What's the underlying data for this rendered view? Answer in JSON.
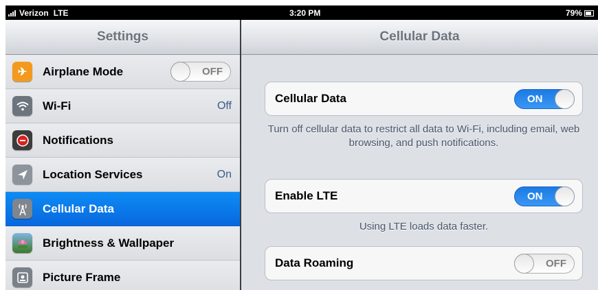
{
  "status_bar": {
    "carrier": "Verizon",
    "network": "LTE",
    "time": "3:20 PM",
    "battery_text": "79%",
    "battery_level": 0.79
  },
  "sidebar": {
    "title": "Settings",
    "items": [
      {
        "label": "Airplane Mode",
        "icon": "airplane-icon",
        "icon_glyph": "✈",
        "icon_color": "#f39a1e",
        "toggle": "OFF"
      },
      {
        "label": "Wi-Fi",
        "icon": "wifi-icon",
        "icon_glyph": "≋",
        "icon_color": "#6c747e",
        "value": "Off"
      },
      {
        "label": "Notifications",
        "icon": "notifications-icon",
        "icon_glyph": "●",
        "icon_color": "#d6241e"
      },
      {
        "label": "Location Services",
        "icon": "location-arrow-icon",
        "icon_glyph": "➤",
        "icon_color": "#8d949c",
        "value": "On"
      },
      {
        "label": "Cellular Data",
        "icon": "cellular-antenna-icon",
        "icon_glyph": "⌖",
        "icon_color": "#7f868e",
        "selected": true
      },
      {
        "label": "Brightness & Wallpaper",
        "icon": "flower-icon",
        "icon_glyph": "✿",
        "icon_color": "#4f8f3a"
      },
      {
        "label": "Picture Frame",
        "icon": "picture-frame-icon",
        "icon_glyph": "▣",
        "icon_color": "#7a8189"
      }
    ]
  },
  "detail": {
    "title": "Cellular Data",
    "cellular_data": {
      "label": "Cellular Data",
      "toggle": "ON"
    },
    "cellular_data_footer": "Turn off cellular data to restrict all data to Wi-Fi, including email, web browsing, and push notifications.",
    "enable_lte": {
      "label": "Enable LTE",
      "toggle": "ON"
    },
    "enable_lte_footer": "Using LTE loads data faster.",
    "data_roaming": {
      "label": "Data Roaming",
      "toggle": "OFF"
    }
  },
  "colors": {
    "selection_blue": "#0b78ea",
    "toggle_on": "#2a8aef"
  }
}
